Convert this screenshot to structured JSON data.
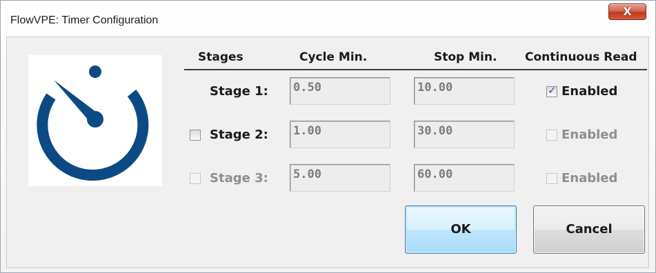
{
  "window": {
    "title": "FlowVPE:  Timer Configuration",
    "close_label": "X"
  },
  "logo": {
    "icon": "stopwatch-icon",
    "color": "#0b4a85"
  },
  "headers": {
    "stages": "Stages",
    "cycle_min": "Cycle Min.",
    "stop_min": "Stop Min.",
    "continuous_read": "Continuous Read"
  },
  "stages": [
    {
      "label": "Stage 1:",
      "cycle": "0.50",
      "stop": "10.00",
      "has_checkbox": false,
      "enabled_label": "Enabled",
      "continuous_checked": true,
      "continuous_disabled": false
    },
    {
      "label": "Stage 2:",
      "cycle": "1.00",
      "stop": "30.00",
      "has_checkbox": true,
      "stage_checked": false,
      "stage_disabled": false,
      "enabled_label": "Enabled",
      "continuous_checked": false,
      "continuous_disabled": true
    },
    {
      "label": "Stage 3:",
      "cycle": "5.00",
      "stop": "60.00",
      "has_checkbox": true,
      "stage_checked": false,
      "stage_disabled": true,
      "enabled_label": "Enabled",
      "continuous_checked": false,
      "continuous_disabled": true
    }
  ],
  "buttons": {
    "ok": "OK",
    "cancel": "Cancel"
  }
}
